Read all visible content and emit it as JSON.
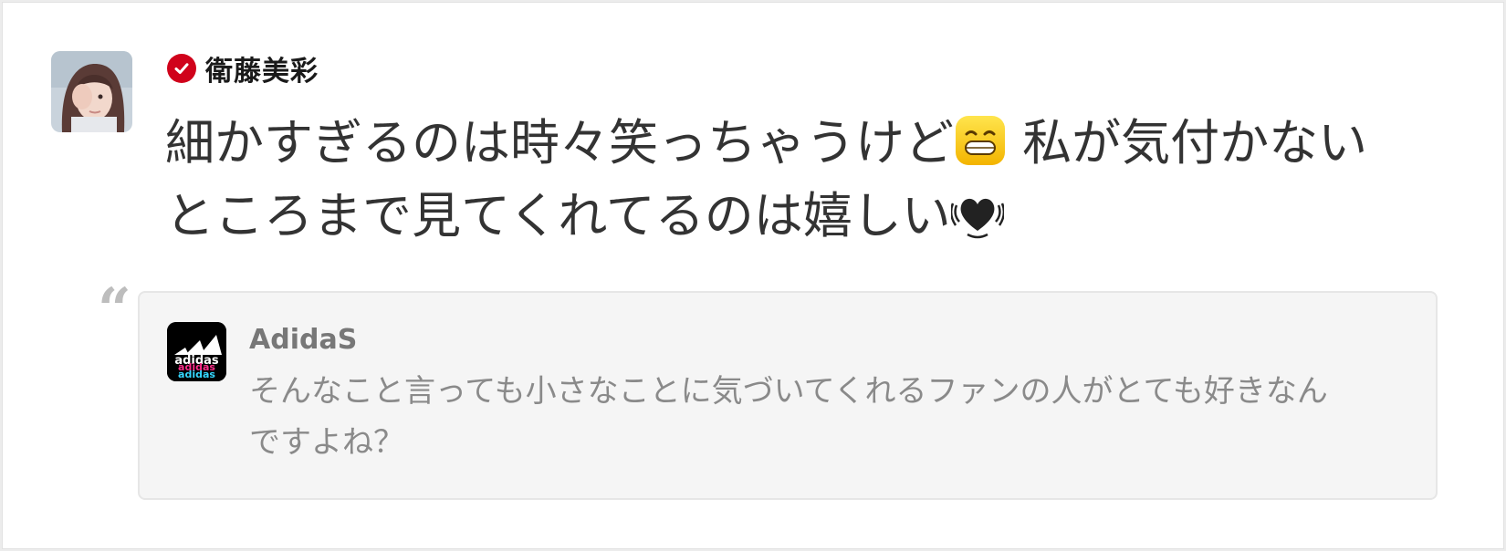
{
  "post": {
    "author_name": "衛藤美彩",
    "verified_icon": "verified-check-icon",
    "line1_a": "細かすぎるのは時々笑っちゃうけど",
    "emoji1": "grinning-face-icon",
    "line1_b": " 私が気付かない",
    "line2_a": "ところまで見てくれてるのは嬉しい",
    "emoji2": "beating-heart-icon"
  },
  "quote": {
    "mark": "“",
    "author_name": "AdidaS",
    "avatar_icon": "adidas-logo-icon",
    "text": "そんなこと言っても小さなことに気づいてくれるファンの人がとても好きなんですよね？"
  },
  "colors": {
    "verified": "#d0021b",
    "text": "#333333",
    "quote_bg": "#f5f5f5",
    "quote_text": "#8a8a8a"
  }
}
